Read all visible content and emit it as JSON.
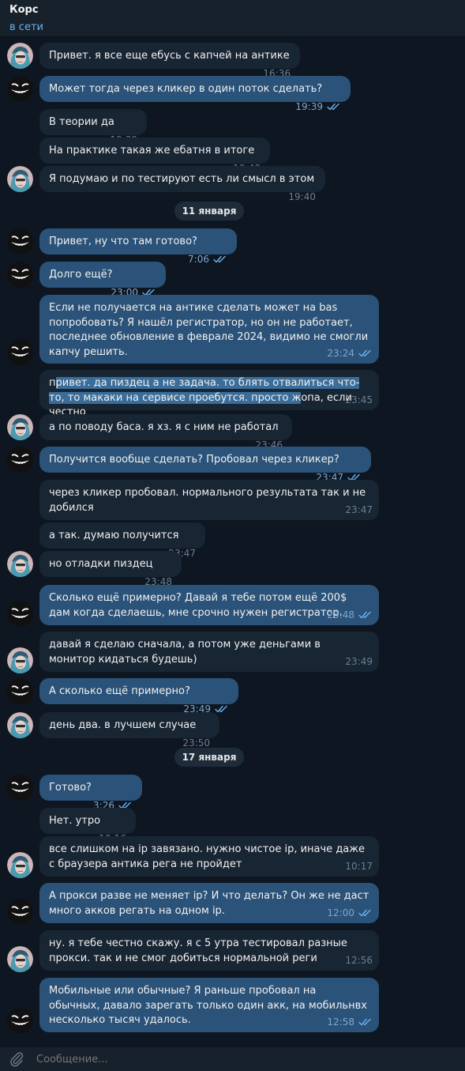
{
  "header": {
    "title": "Корс",
    "status": "в сети"
  },
  "dates": [
    "11 января",
    "17 января"
  ],
  "messages": [
    {
      "text": "Привет. я все еще ебусь с капчей на антике",
      "time": "16:36"
    },
    {
      "text": "Может тогда через кликер в один поток сделать?",
      "time": "19:39"
    },
    {
      "text": "В теории да",
      "time": "19:39"
    },
    {
      "text": "На практике такая же ебатня в итоге",
      "time": "19:40"
    },
    {
      "text": "Я подумаю и по тестируют есть ли смысл в этом",
      "time": "19:40"
    },
    {
      "text": "Привет, ну что там готово?",
      "time": "7:06"
    },
    {
      "text": "Долго ещё?",
      "time": "23:00"
    },
    {
      "text": "Если не получается на антике сделать может на bas попробовать? Я нашёл регистратор, но он не работает, последнее обновление в феврале 2024, видимо не смогли капчу решить.",
      "time": "23:24"
    },
    {
      "text_pre": "п",
      "text_sel": "ривет. да пиздец а не задача. то блять отвалиться что-то, то макаки на сервисе проебутся. просто ж",
      "text_post": "опа, если честно",
      "time": "23:45"
    },
    {
      "text": "а по поводу баса. я хз. я с ним не работал",
      "time": "23:46"
    },
    {
      "text": "Получится вообще сделать? Пробовал через кликер?",
      "time": "23:47"
    },
    {
      "text": "через кликер пробовал. нормального результата так и не добился",
      "time": "23:47"
    },
    {
      "text": "а так. думаю получится",
      "time": "23:47"
    },
    {
      "text": "но отладки пиздец",
      "time": "23:48"
    },
    {
      "text": "Сколько ещё примерно? Давай я тебе потом ещё 200$ дам когда сделаешь, мне срочно нужен регистратор.",
      "time": "23:48"
    },
    {
      "text": "давай я сделаю сначала, а потом уже деньгами в монитор кидаться будешь)",
      "time": "23:49"
    },
    {
      "text": "А сколько ещё примерно?",
      "time": "23:49"
    },
    {
      "text": "день два. в лучшем случае",
      "time": "23:50"
    },
    {
      "text": "Готово?",
      "time": "3:26"
    },
    {
      "text": "Нет. утро",
      "time": "10:16"
    },
    {
      "text": "все слишком на ip завязано. нужно чистое ip, иначе даже с браузера антика рега не пройдет",
      "time": "10:17"
    },
    {
      "text": "А прокси разве не меняет ip? И что делать? Он же не даст много акков регать на одном ip.",
      "time": "12:00"
    },
    {
      "text": "ну. я тебе честно скажу. я с 5 утра тестировал разные прокси. так и не смог добиться нормальной реги",
      "time": "12:56"
    },
    {
      "text": "Мобильные или обычные? Я раньше пробовал на обычных, давало зарегать только один акк, на мобильнвх несколько тысяч удалось.",
      "time": "12:58"
    }
  ],
  "composer": {
    "placeholder": "Сообщение..."
  },
  "colors": {
    "bg": "#0e1621",
    "incoming": "#182533",
    "outgoing": "#2b5278",
    "accent": "#6ab2f2"
  }
}
